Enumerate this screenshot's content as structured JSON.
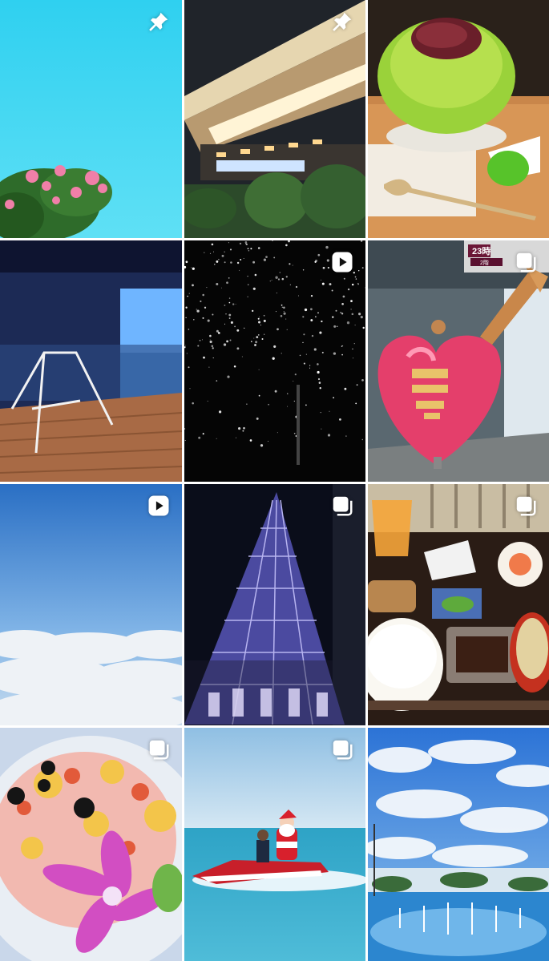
{
  "grid": {
    "posts": [
      {
        "id": "sky-crape-myrtle",
        "badge": "pin"
      },
      {
        "id": "kokugikan-night",
        "badge": "pin"
      },
      {
        "id": "matcha-shaved-ice",
        "badge": "none"
      },
      {
        "id": "terrace-swing",
        "badge": "none"
      },
      {
        "id": "starry-lights",
        "badge": "video"
      },
      {
        "id": "heart-mailbox",
        "badge": "carousel"
      },
      {
        "id": "sky-above-clouds",
        "badge": "video"
      },
      {
        "id": "glass-building-night",
        "badge": "carousel"
      },
      {
        "id": "japanese-breakfast",
        "badge": "carousel"
      },
      {
        "id": "flower-salad",
        "badge": "carousel"
      },
      {
        "id": "santa-jetski",
        "badge": "carousel"
      },
      {
        "id": "fountain-sky",
        "badge": "none"
      }
    ],
    "signage": {
      "hours": "23時",
      "arrow_sign": "2階"
    }
  }
}
